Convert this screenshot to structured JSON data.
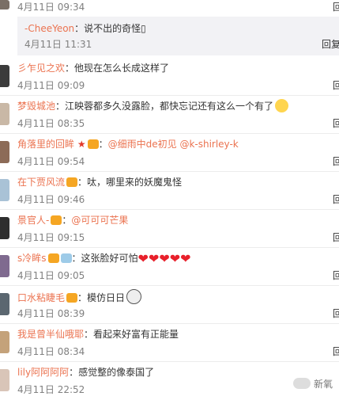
{
  "top_fragment": {
    "time": "4月11日 09:34",
    "reply": "回"
  },
  "sub_reply": {
    "user": "-CheeYeon",
    "text": "：说不出的奇怪▯",
    "time": "4月11日 11:31",
    "reply": "回复"
  },
  "comments": [
    {
      "user": "彡乍见之欢",
      "sep": "：",
      "text": "他现在怎么长成这样了",
      "time": "4月11日 09:09",
      "reply": "回"
    },
    {
      "user": "梦毁城池",
      "sep": "：",
      "text": "江映蓉都多久没露脸，都快忘记还有这么一个有了",
      "time": "4月11日 08:35",
      "reply": "回"
    },
    {
      "user": "角落里的回眸",
      "sep": "：",
      "text": "@细雨中de初见 @k-shirley-k",
      "time": "4月11日 09:54",
      "reply": "回"
    },
    {
      "user": "在下贾风流",
      "sep": "：",
      "text": "呔，哪里来的妖魔鬼怪",
      "time": "4月11日 09:46",
      "reply": "回"
    },
    {
      "user": "景官人-",
      "sep": "：",
      "text": "@可可可芒果",
      "time": "4月11日 09:15",
      "reply": "回"
    },
    {
      "user": "s冷眸s",
      "sep": "：",
      "text": "这张脸好可怕",
      "time": "4月11日 09:05",
      "reply": "回"
    },
    {
      "user": "口水粘睫毛",
      "sep": "：",
      "text": "模仿日日",
      "time": "4月11日 08:39",
      "reply": "回"
    },
    {
      "user": "我是曾半仙哦耶",
      "sep": "：",
      "text": "看起来好富有正能量",
      "time": "4月11日 08:34",
      "reply": "回"
    },
    {
      "user": "lily阿阿阿阿",
      "sep": "：",
      "text": "感觉整的像泰国了",
      "time": "4月11日 22:52",
      "reply": "回"
    }
  ],
  "watermark": {
    "text": "新氧"
  },
  "colors": {
    "username": "#eb7350",
    "timestamp": "#808080",
    "subreply_bg": "#f2f2f5"
  },
  "icons": {
    "vip_badge": "vip-crown-icon",
    "star": "star-icon",
    "hearts": "heart-emoji-icon"
  }
}
